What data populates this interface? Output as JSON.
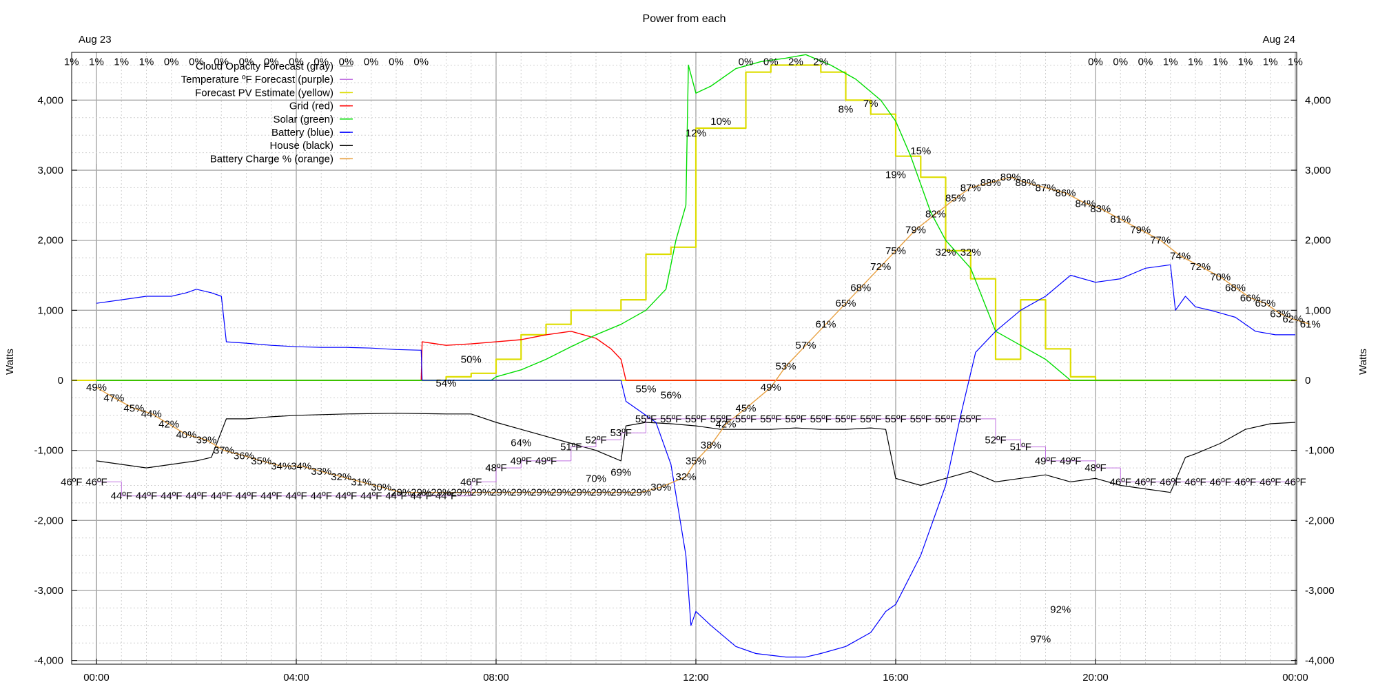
{
  "chart_data": {
    "type": "line",
    "title": "Power from each",
    "ylabel_left": "Watts",
    "ylabel_right": "Watts",
    "date_start_label": "Aug 23",
    "date_end_label": "Aug 24",
    "xlim_hours": [
      0,
      24
    ],
    "ylim": [
      -4000,
      4500
    ],
    "grid": true,
    "legend_position": "top-left",
    "x_ticks": [
      {
        "h": 0,
        "label": "00:00"
      },
      {
        "h": 4,
        "label": "04:00"
      },
      {
        "h": 8,
        "label": "08:00"
      },
      {
        "h": 12,
        "label": "12:00"
      },
      {
        "h": 16,
        "label": "16:00"
      },
      {
        "h": 20,
        "label": "20:00"
      },
      {
        "h": 24,
        "label": "00:00"
      }
    ],
    "y_ticks": [
      {
        "v": 4000,
        "label": "4,000"
      },
      {
        "v": 3000,
        "label": "3,000"
      },
      {
        "v": 2000,
        "label": "2,000"
      },
      {
        "v": 1000,
        "label": "1,000"
      },
      {
        "v": 0,
        "label": "0"
      },
      {
        "v": -1000,
        "label": "-1,000"
      },
      {
        "v": -2000,
        "label": "-2,000"
      },
      {
        "v": -3000,
        "label": "-3,000"
      },
      {
        "v": -4000,
        "label": "-4,000"
      }
    ],
    "series": [
      {
        "name": "Cloud Opacity Forecast (gray)",
        "color": "#b0b0b0"
      },
      {
        "name": "Temperature ºF Forecast (purple)",
        "color": "#c070e0"
      },
      {
        "name": "Forecast PV Estimate (yellow)",
        "color": "#dddd00"
      },
      {
        "name": "Grid (red)",
        "color": "#ff0000"
      },
      {
        "name": "Solar (green)",
        "color": "#00dd00"
      },
      {
        "name": "Battery (blue)",
        "color": "#0000ff"
      },
      {
        "name": "House (black)",
        "color": "#000000"
      },
      {
        "name": "Battery Charge % (orange)",
        "color": "#e8a040"
      }
    ],
    "battery_blue": [
      [
        0,
        1100
      ],
      [
        0.5,
        1150
      ],
      [
        1,
        1200
      ],
      [
        1.5,
        1200
      ],
      [
        1.8,
        1250
      ],
      [
        2,
        1300
      ],
      [
        2.3,
        1250
      ],
      [
        2.5,
        1200
      ],
      [
        2.6,
        550
      ],
      [
        3,
        530
      ],
      [
        3.5,
        500
      ],
      [
        4,
        480
      ],
      [
        4.5,
        470
      ],
      [
        5,
        470
      ],
      [
        5.5,
        460
      ],
      [
        6,
        440
      ],
      [
        6.5,
        430
      ],
      [
        6.52,
        0
      ],
      [
        7,
        0
      ],
      [
        8,
        0
      ],
      [
        9,
        0
      ],
      [
        10,
        0
      ],
      [
        10.5,
        0
      ],
      [
        10.6,
        -300
      ],
      [
        10.9,
        -450
      ],
      [
        11.2,
        -600
      ],
      [
        11.5,
        -1200
      ],
      [
        11.8,
        -2500
      ],
      [
        11.9,
        -3500
      ],
      [
        12,
        -3300
      ],
      [
        12.3,
        -3500
      ],
      [
        12.8,
        -3800
      ],
      [
        13.2,
        -3900
      ],
      [
        13.8,
        -3950
      ],
      [
        14.2,
        -3950
      ],
      [
        14.5,
        -3900
      ],
      [
        15,
        -3800
      ],
      [
        15.5,
        -3600
      ],
      [
        15.8,
        -3300
      ],
      [
        16,
        -3200
      ],
      [
        16.5,
        -2500
      ],
      [
        17,
        -1500
      ],
      [
        17.3,
        -500
      ],
      [
        17.6,
        400
      ],
      [
        18,
        700
      ],
      [
        18.5,
        1000
      ],
      [
        19,
        1200
      ],
      [
        19.5,
        1500
      ],
      [
        20,
        1400
      ],
      [
        20.5,
        1450
      ],
      [
        21,
        1600
      ],
      [
        21.5,
        1650
      ],
      [
        21.6,
        1000
      ],
      [
        21.8,
        1200
      ],
      [
        22,
        1050
      ],
      [
        22.3,
        1000
      ],
      [
        22.8,
        900
      ],
      [
        23.2,
        700
      ],
      [
        23.6,
        650
      ],
      [
        24,
        650
      ]
    ],
    "house_black": [
      [
        0,
        -1150
      ],
      [
        0.5,
        -1200
      ],
      [
        1,
        -1250
      ],
      [
        1.5,
        -1200
      ],
      [
        2,
        -1150
      ],
      [
        2.3,
        -1100
      ],
      [
        2.6,
        -550
      ],
      [
        3,
        -550
      ],
      [
        3.5,
        -520
      ],
      [
        4,
        -500
      ],
      [
        5,
        -480
      ],
      [
        6,
        -470
      ],
      [
        7,
        -480
      ],
      [
        7.5,
        -480
      ],
      [
        8,
        -600
      ],
      [
        8.5,
        -700
      ],
      [
        9,
        -800
      ],
      [
        9.5,
        -900
      ],
      [
        10,
        -1000
      ],
      [
        10.5,
        -1150
      ],
      [
        10.6,
        -650
      ],
      [
        11,
        -600
      ],
      [
        11.5,
        -620
      ],
      [
        12,
        -650
      ],
      [
        12.5,
        -700
      ],
      [
        13,
        -700
      ],
      [
        13.5,
        -700
      ],
      [
        14,
        -680
      ],
      [
        14.5,
        -700
      ],
      [
        15,
        -700
      ],
      [
        15.5,
        -680
      ],
      [
        15.8,
        -700
      ],
      [
        16,
        -1400
      ],
      [
        16.5,
        -1500
      ],
      [
        17,
        -1400
      ],
      [
        17.5,
        -1300
      ],
      [
        18,
        -1450
      ],
      [
        18.5,
        -1400
      ],
      [
        19,
        -1350
      ],
      [
        19.5,
        -1450
      ],
      [
        20,
        -1400
      ],
      [
        20.5,
        -1500
      ],
      [
        21,
        -1550
      ],
      [
        21.5,
        -1600
      ],
      [
        21.8,
        -1100
      ],
      [
        22,
        -1050
      ],
      [
        22.5,
        -900
      ],
      [
        23,
        -700
      ],
      [
        23.5,
        -620
      ],
      [
        24,
        -600
      ]
    ],
    "grid_red": [
      [
        0,
        0
      ],
      [
        6.5,
        0
      ],
      [
        6.52,
        550
      ],
      [
        7,
        500
      ],
      [
        7.5,
        520
      ],
      [
        8,
        550
      ],
      [
        8.5,
        580
      ],
      [
        9,
        650
      ],
      [
        9.5,
        700
      ],
      [
        10,
        600
      ],
      [
        10.3,
        450
      ],
      [
        10.5,
        300
      ],
      [
        10.6,
        0
      ],
      [
        24,
        0
      ]
    ],
    "solar_green": [
      [
        0,
        0
      ],
      [
        7.9,
        0
      ],
      [
        8,
        50
      ],
      [
        8.5,
        150
      ],
      [
        9,
        300
      ],
      [
        9.5,
        480
      ],
      [
        10,
        650
      ],
      [
        10.5,
        800
      ],
      [
        11,
        1000
      ],
      [
        11.4,
        1300
      ],
      [
        11.6,
        2000
      ],
      [
        11.8,
        2500
      ],
      [
        11.85,
        4500
      ],
      [
        12,
        4100
      ],
      [
        12.3,
        4200
      ],
      [
        12.8,
        4450
      ],
      [
        13.3,
        4550
      ],
      [
        13.8,
        4600
      ],
      [
        14.2,
        4650
      ],
      [
        14.7,
        4500
      ],
      [
        15.2,
        4300
      ],
      [
        15.7,
        4000
      ],
      [
        16,
        3700
      ],
      [
        16.3,
        3200
      ],
      [
        16.7,
        2400
      ],
      [
        17,
        2000
      ],
      [
        17.5,
        1600
      ],
      [
        18,
        700
      ],
      [
        18.5,
        500
      ],
      [
        19,
        300
      ],
      [
        19.5,
        0
      ],
      [
        24,
        0
      ]
    ],
    "forecast_yellow": [
      [
        6.5,
        0
      ],
      [
        7,
        50
      ],
      [
        7.5,
        100
      ],
      [
        8,
        300
      ],
      [
        8.5,
        650
      ],
      [
        9,
        800
      ],
      [
        9.5,
        1000
      ],
      [
        10,
        1000
      ],
      [
        10.5,
        1150
      ],
      [
        11,
        1800
      ],
      [
        11.5,
        1900
      ],
      [
        12,
        3600
      ],
      [
        12.5,
        3600
      ],
      [
        13,
        4400
      ],
      [
        13.5,
        4500
      ],
      [
        14,
        4500
      ],
      [
        14.5,
        4400
      ],
      [
        15,
        4000
      ],
      [
        15.5,
        3800
      ],
      [
        16,
        3200
      ],
      [
        16.5,
        2900
      ],
      [
        17,
        1850
      ],
      [
        17.5,
        1450
      ],
      [
        18,
        300
      ],
      [
        18.5,
        1150
      ],
      [
        19,
        450
      ],
      [
        19.5,
        50
      ],
      [
        20,
        0
      ],
      [
        24,
        0
      ]
    ],
    "battery_pct_orange": [
      {
        "h": 0,
        "v": "49%"
      },
      {
        "h": 0.35,
        "v": "47%"
      },
      {
        "h": 0.75,
        "v": "45%"
      },
      {
        "h": 1.1,
        "v": "44%"
      },
      {
        "h": 1.45,
        "v": "42%"
      },
      {
        "h": 1.8,
        "v": "40%"
      },
      {
        "h": 2.2,
        "v": "39%"
      },
      {
        "h": 2.55,
        "v": "37%"
      },
      {
        "h": 2.95,
        "v": "36%"
      },
      {
        "h": 3.3,
        "v": "35%"
      },
      {
        "h": 3.7,
        "v": "34%"
      },
      {
        "h": 4.1,
        "v": "34%"
      },
      {
        "h": 4.5,
        "v": "33%"
      },
      {
        "h": 4.9,
        "v": "32%"
      },
      {
        "h": 5.3,
        "v": "31%"
      },
      {
        "h": 5.7,
        "v": "30%"
      },
      {
        "h": 6.1,
        "v": "29%"
      },
      {
        "h": 6.5,
        "v": "29%"
      },
      {
        "h": 6.9,
        "v": "29%"
      },
      {
        "h": 7.3,
        "v": "29%"
      },
      {
        "h": 7.7,
        "v": "29%"
      },
      {
        "h": 8.1,
        "v": "29%"
      },
      {
        "h": 8.5,
        "v": "29%"
      },
      {
        "h": 8.9,
        "v": "29%"
      },
      {
        "h": 9.3,
        "v": "29%"
      },
      {
        "h": 9.7,
        "v": "29%"
      },
      {
        "h": 10.1,
        "v": "29%"
      },
      {
        "h": 10.5,
        "v": "29%"
      },
      {
        "h": 10.9,
        "v": "29%"
      },
      {
        "h": 11.3,
        "v": "30%"
      },
      {
        "h": 11.8,
        "v": "32%"
      },
      {
        "h": 12.0,
        "v": "35%"
      },
      {
        "h": 12.3,
        "v": "38%"
      },
      {
        "h": 12.6,
        "v": "42%"
      },
      {
        "h": 13.0,
        "v": "45%"
      },
      {
        "h": 13.5,
        "v": "49%"
      },
      {
        "h": 13.8,
        "v": "53%"
      },
      {
        "h": 14.2,
        "v": "57%"
      },
      {
        "h": 14.6,
        "v": "61%"
      },
      {
        "h": 15.0,
        "v": "65%"
      },
      {
        "h": 15.3,
        "v": "68%"
      },
      {
        "h": 15.7,
        "v": "72%"
      },
      {
        "h": 16.0,
        "v": "75%"
      },
      {
        "h": 16.4,
        "v": "79%"
      },
      {
        "h": 16.8,
        "v": "82%"
      },
      {
        "h": 17.2,
        "v": "85%"
      },
      {
        "h": 17.5,
        "v": "87%"
      },
      {
        "h": 17.9,
        "v": "88%"
      },
      {
        "h": 18.3,
        "v": "89%"
      },
      {
        "h": 18.6,
        "v": "88%"
      },
      {
        "h": 19.0,
        "v": "87%"
      },
      {
        "h": 19.4,
        "v": "86%"
      },
      {
        "h": 19.8,
        "v": "84%"
      },
      {
        "h": 20.1,
        "v": "83%"
      },
      {
        "h": 20.5,
        "v": "81%"
      },
      {
        "h": 20.9,
        "v": "79%"
      },
      {
        "h": 21.3,
        "v": "77%"
      },
      {
        "h": 21.7,
        "v": "74%"
      },
      {
        "h": 22.1,
        "v": "72%"
      },
      {
        "h": 22.5,
        "v": "70%"
      },
      {
        "h": 22.8,
        "v": "68%"
      },
      {
        "h": 23.1,
        "v": "66%"
      },
      {
        "h": 23.4,
        "v": "65%"
      },
      {
        "h": 23.7,
        "v": "63%"
      },
      {
        "h": 23.95,
        "v": "62%"
      },
      {
        "h": 24.3,
        "v": "61%"
      }
    ],
    "temperature_purple": [
      {
        "h": -0.5,
        "v": "46ºF"
      },
      {
        "h": 0.0,
        "v": "46ºF"
      },
      {
        "h": 0.5,
        "v": "44ºF"
      },
      {
        "h": 1.0,
        "v": "44ºF"
      },
      {
        "h": 1.5,
        "v": "44ºF"
      },
      {
        "h": 2.0,
        "v": "44ºF"
      },
      {
        "h": 2.5,
        "v": "44ºF"
      },
      {
        "h": 3.0,
        "v": "44ºF"
      },
      {
        "h": 3.5,
        "v": "44ºF"
      },
      {
        "h": 4.0,
        "v": "44ºF"
      },
      {
        "h": 4.5,
        "v": "44ºF"
      },
      {
        "h": 5.0,
        "v": "44ºF"
      },
      {
        "h": 5.5,
        "v": "44ºF"
      },
      {
        "h": 6.0,
        "v": "44ºF"
      },
      {
        "h": 6.5,
        "v": "44ºF"
      },
      {
        "h": 7.0,
        "v": "44ºF"
      },
      {
        "h": 7.5,
        "v": "46ºF"
      },
      {
        "h": 8.0,
        "v": "48ºF"
      },
      {
        "h": 8.5,
        "v": "49ºF"
      },
      {
        "h": 9.0,
        "v": "49ºF"
      },
      {
        "h": 9.5,
        "v": "51ºF"
      },
      {
        "h": 10.0,
        "v": "52ºF"
      },
      {
        "h": 10.5,
        "v": "53ºF"
      },
      {
        "h": 11.0,
        "v": "55ºF"
      },
      {
        "h": 11.5,
        "v": "55ºF"
      },
      {
        "h": 12.0,
        "v": "55ºF"
      },
      {
        "h": 12.5,
        "v": "55ºF"
      },
      {
        "h": 13.0,
        "v": "55ºF"
      },
      {
        "h": 13.5,
        "v": "55ºF"
      },
      {
        "h": 14.0,
        "v": "55ºF"
      },
      {
        "h": 14.5,
        "v": "55ºF"
      },
      {
        "h": 15.0,
        "v": "55ºF"
      },
      {
        "h": 15.5,
        "v": "55ºF"
      },
      {
        "h": 16.0,
        "v": "55ºF"
      },
      {
        "h": 16.5,
        "v": "55ºF"
      },
      {
        "h": 17.0,
        "v": "55ºF"
      },
      {
        "h": 17.5,
        "v": "55ºF"
      },
      {
        "h": 18.0,
        "v": "52ºF"
      },
      {
        "h": 18.5,
        "v": "51ºF"
      },
      {
        "h": 19.0,
        "v": "49ºF"
      },
      {
        "h": 19.5,
        "v": "49ºF"
      },
      {
        "h": 20.0,
        "v": "48ºF"
      },
      {
        "h": 20.5,
        "v": "46ºF"
      },
      {
        "h": 21.0,
        "v": "46ºF"
      },
      {
        "h": 21.5,
        "v": "46ºF"
      },
      {
        "h": 22.0,
        "v": "46ºF"
      },
      {
        "h": 22.5,
        "v": "46ºF"
      },
      {
        "h": 23.0,
        "v": "46ºF"
      },
      {
        "h": 23.5,
        "v": "46ºF"
      },
      {
        "h": 24.0,
        "v": "46ºF"
      }
    ],
    "cloud_gray": [
      {
        "h": -0.5,
        "v": "1%"
      },
      {
        "h": 0.0,
        "v": "1%"
      },
      {
        "h": 0.5,
        "v": "1%"
      },
      {
        "h": 1.0,
        "v": "1%"
      },
      {
        "h": 1.5,
        "v": "0%"
      },
      {
        "h": 2.0,
        "v": "0%"
      },
      {
        "h": 2.5,
        "v": "0%"
      },
      {
        "h": 3.0,
        "v": "0%"
      },
      {
        "h": 3.5,
        "v": "0%"
      },
      {
        "h": 4.0,
        "v": "0%"
      },
      {
        "h": 4.5,
        "v": "0%"
      },
      {
        "h": 5.0,
        "v": "0%"
      },
      {
        "h": 5.5,
        "v": "0%"
      },
      {
        "h": 6.0,
        "v": "0%"
      },
      {
        "h": 6.5,
        "v": "0%"
      },
      {
        "h": 7.0,
        "v": "54%"
      },
      {
        "h": 7.5,
        "v": "50%"
      },
      {
        "h": 8.5,
        "v": "64%"
      },
      {
        "h": 10.0,
        "v": "70%"
      },
      {
        "h": 10.5,
        "v": "69%"
      },
      {
        "h": 11.0,
        "v": "55%"
      },
      {
        "h": 11.5,
        "v": "56%"
      },
      {
        "h": 12.0,
        "v": "12%"
      },
      {
        "h": 12.5,
        "v": "10%"
      },
      {
        "h": 13.0,
        "v": "0%"
      },
      {
        "h": 13.5,
        "v": "0%"
      },
      {
        "h": 14.0,
        "v": "2%"
      },
      {
        "h": 14.5,
        "v": "2%"
      },
      {
        "h": 15.0,
        "v": "8%"
      },
      {
        "h": 15.5,
        "v": "7%"
      },
      {
        "h": 16.0,
        "v": "19%"
      },
      {
        "h": 16.5,
        "v": "15%"
      },
      {
        "h": 17.0,
        "v": "32%"
      },
      {
        "h": 17.5,
        "v": "32%"
      },
      {
        "h": 20.0,
        "v": "0%"
      },
      {
        "h": 20.5,
        "v": "0%"
      },
      {
        "h": 21.0,
        "v": "0%"
      },
      {
        "h": 21.5,
        "v": "1%"
      },
      {
        "h": 22.0,
        "v": "1%"
      },
      {
        "h": 22.5,
        "v": "1%"
      },
      {
        "h": 23.0,
        "v": "1%"
      },
      {
        "h": 23.5,
        "v": "1%"
      },
      {
        "h": 24.0,
        "v": "1%"
      },
      {
        "h": 19.3,
        "v": "92%"
      },
      {
        "h": 18.9,
        "v": "97%"
      }
    ]
  }
}
